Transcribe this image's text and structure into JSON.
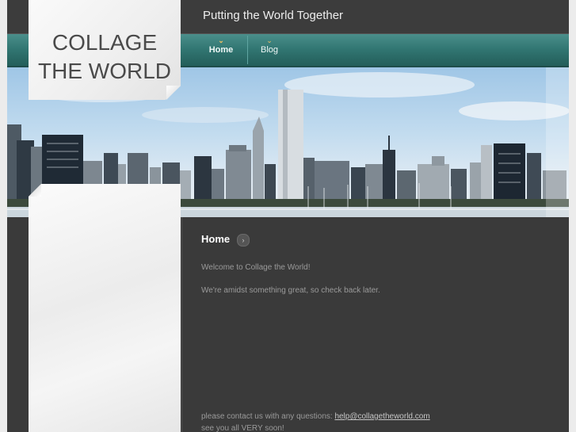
{
  "site": {
    "logo_text": "COLLAGE THE WORLD",
    "tagline": "Putting the World Together"
  },
  "nav": {
    "items": [
      {
        "label": "Home",
        "active": true
      },
      {
        "label": "Blog",
        "active": false
      }
    ],
    "chevron_icon": "chevron-down-icon",
    "accent_color": "#2e726e"
  },
  "banner": {
    "icon": "city-skyline-banner"
  },
  "content": {
    "title": "Home",
    "title_icon": "arrow-right-circle-icon",
    "welcome": "Welcome to Collage the World!",
    "message": "We're amidst something great, so check back later.",
    "contact_prefix": "please contact us with any questions: ",
    "contact_email": "help@collagetheworld.com",
    "signoff": "see you all VERY soon!"
  },
  "colors": {
    "page_bg": "#3a3a3a",
    "outer_bg": "#ececec",
    "nav_teal": "#327773",
    "chevron": "#f0c060"
  }
}
